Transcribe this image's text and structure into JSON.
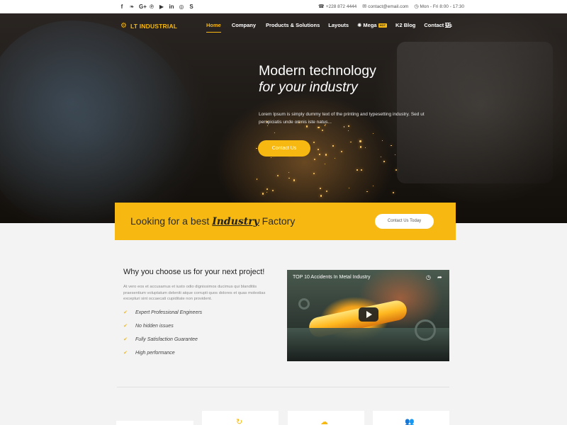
{
  "topbar": {
    "social_icons": [
      "facebook-icon",
      "twitter-icon",
      "google-plus-icon",
      "pinterest-icon",
      "youtube-icon",
      "linkedin-icon",
      "instagram-icon",
      "skype-icon"
    ],
    "social_glyphs": [
      "f",
      "❧",
      "G+",
      "℗",
      "▶",
      "in",
      "◎",
      "S"
    ],
    "phone": "+228 872 4444",
    "email": "contact@email.com",
    "hours": "Mon - Fri 8:00 - 17:30"
  },
  "header": {
    "logo_text": "LT INDUSTRIAL",
    "nav": [
      {
        "label": "Home",
        "active": true
      },
      {
        "label": "Company"
      },
      {
        "label": "Products & Solutions"
      },
      {
        "label": "Layouts"
      },
      {
        "label": "Mega",
        "badge": "HOT"
      },
      {
        "label": "K2 Blog"
      },
      {
        "label": "Contact Us"
      }
    ]
  },
  "hero": {
    "title": "Modern technology",
    "subtitle": "for your industry",
    "description": "Lorem Ipsum is simply dummy text of the printing and typesetting industry. Sed ut perspiciatis unde omnis iste natus...",
    "button_label": "Contact Us"
  },
  "band": {
    "text_before": "Looking for a best ",
    "text_emphasis": "Industry",
    "text_after": " Factory",
    "button_label": "Contact Us Today"
  },
  "why": {
    "title": "Why you choose us for your next project!",
    "description": "At vero eos et accusamus et iusto odio dignissimos ducimus qui blanditiis praesentium voluptatum deleniti atque corrupti quos dolores et quas molestias excepturi sint occaecati cupiditate non provident.",
    "features": [
      "Expert Professional Engineers",
      "No hidden issues",
      "Fully Satisfaction Guarantee",
      "High performance"
    ]
  },
  "video": {
    "title": "TOP 10 Accidents In Metal Industry"
  },
  "colors": {
    "accent": "#f7b911",
    "dark": "#1b1713"
  }
}
